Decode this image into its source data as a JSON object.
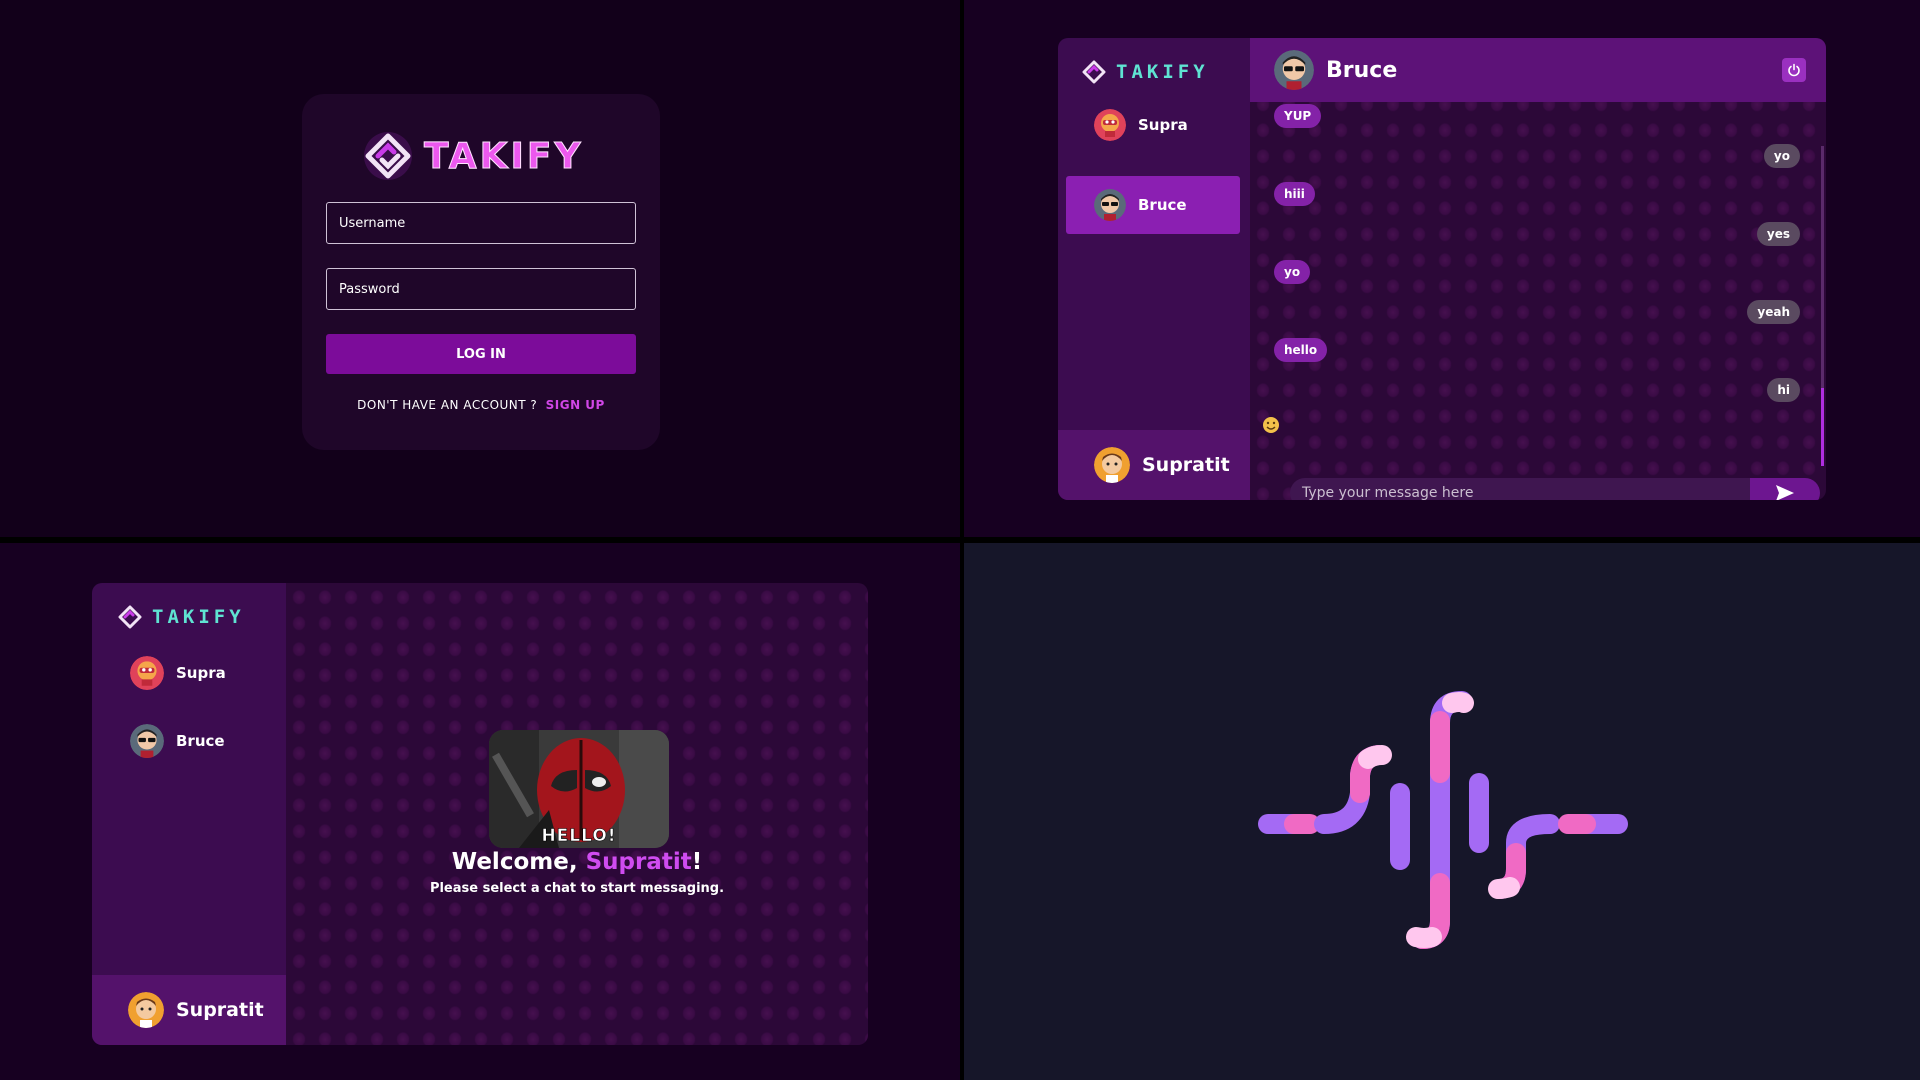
{
  "brand": {
    "name_login": "TAKIFY",
    "name_sidebar": "TAKIFY"
  },
  "login": {
    "username_placeholder": "Username",
    "password_placeholder": "Password",
    "login_button": "LOG IN",
    "signup_prompt": "DON'T HAVE AN ACCOUNT ?",
    "signup_link": "SIGN UP"
  },
  "contacts": [
    {
      "name": "Supra",
      "avatar": "red-robot-avatar"
    },
    {
      "name": "Bruce",
      "avatar": "sunglasses-man-avatar"
    }
  ],
  "current_user": {
    "name": "Supratit",
    "avatar": "boy-avatar"
  },
  "chat": {
    "active_contact": "Bruce",
    "header_name": "Bruce",
    "messages": [
      {
        "text": "YUP",
        "direction": "in"
      },
      {
        "text": "yo",
        "direction": "out"
      },
      {
        "text": "hiii",
        "direction": "in"
      },
      {
        "text": "yes",
        "direction": "out"
      },
      {
        "text": "yo",
        "direction": "in"
      },
      {
        "text": "yeah",
        "direction": "out"
      },
      {
        "text": "hello",
        "direction": "in"
      },
      {
        "text": "hi",
        "direction": "out"
      }
    ],
    "input_placeholder": "Type your message here"
  },
  "home": {
    "gif_caption": "HELLO!",
    "welcome_prefix": "Welcome, ",
    "welcome_name": "Supratit",
    "welcome_suffix": "!",
    "subtitle": "Please select a chat to start messaging."
  },
  "colors": {
    "accent": "#8b1fb2",
    "brand_pink": "#ec58ee",
    "brand_teal": "#5fe3d2",
    "highlight": "#cf4cf0"
  },
  "icons": {
    "brand": "diamond-arrows-logo-icon",
    "power": "power-icon",
    "emoji": "smiley-icon",
    "send": "send-icon",
    "soundwave": "soundwave-logo-icon"
  }
}
